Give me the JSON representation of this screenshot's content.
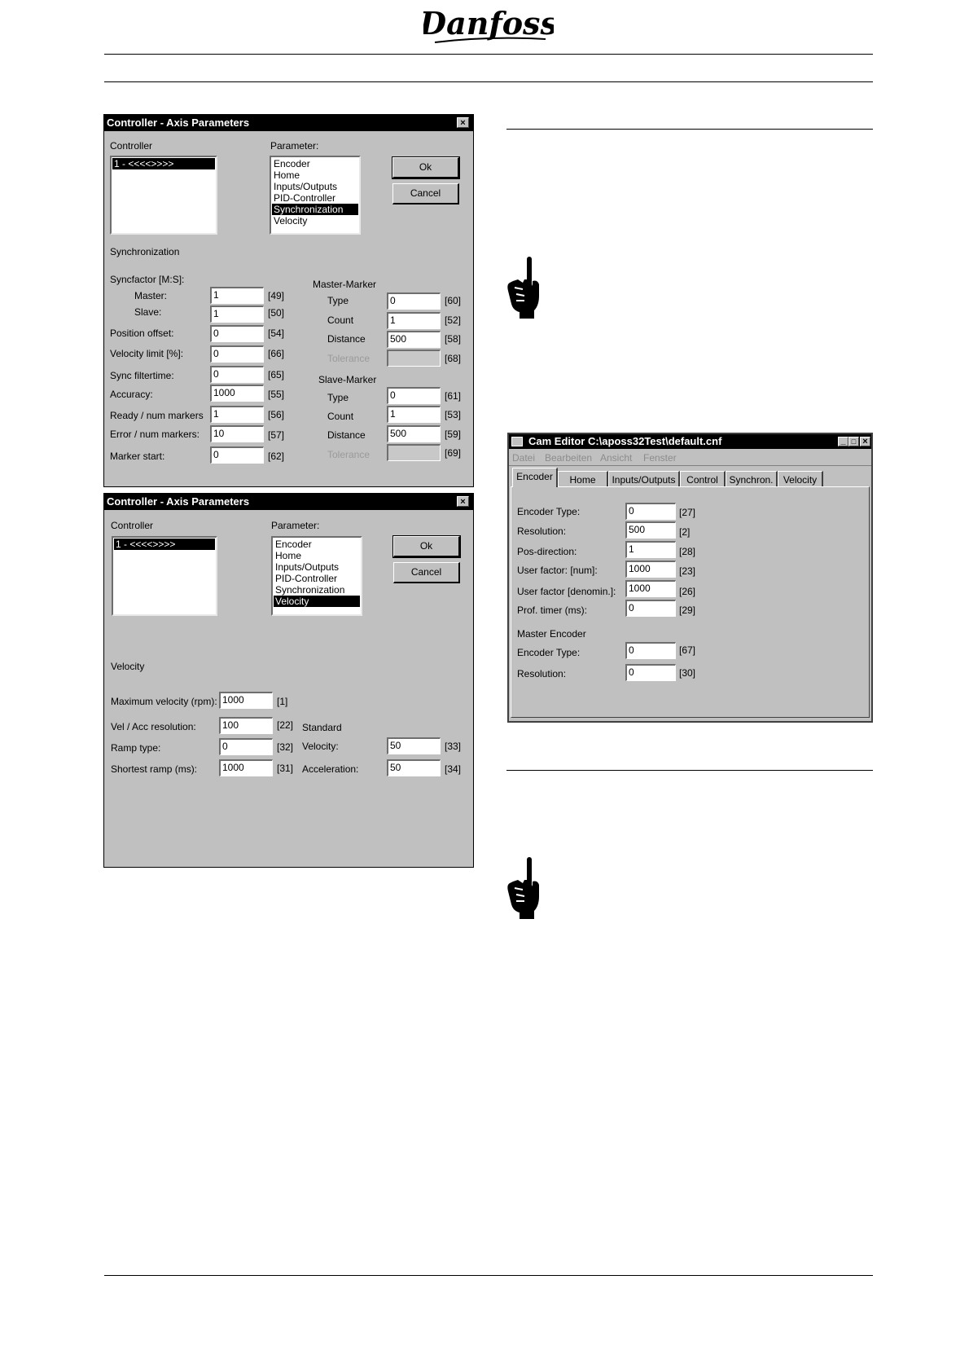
{
  "brand": {
    "logo_text": "Danfoss"
  },
  "dialog1": {
    "title": "Controller - Axis Parameters",
    "close": "×",
    "controller_label": "Controller",
    "controller_items": [
      "1 - <<<<>>>>"
    ],
    "parameter_label": "Parameter:",
    "parameter_items": [
      "Encoder",
      "Home",
      "Inputs/Outputs",
      "PID-Controller",
      "Synchronization",
      "Velocity"
    ],
    "ok": "Ok",
    "cancel": "Cancel",
    "section": "Synchronization",
    "syncfactor": "Syncfactor [M:S]:",
    "left": [
      {
        "label": "Master:",
        "value": "1",
        "code": "[49]"
      },
      {
        "label": "Slave:",
        "value": "1",
        "code": "[50]"
      },
      {
        "label": "Position offset:",
        "value": "0",
        "code": "[54]"
      },
      {
        "label": "Velocity limit [%]:",
        "value": "0",
        "code": "[66]"
      },
      {
        "label": "Sync filtertime:",
        "value": "0",
        "code": "[65]"
      },
      {
        "label": "Accuracy:",
        "value": "1000",
        "code": "[55]"
      },
      {
        "label": "Ready / num markers",
        "value": "1",
        "code": "[56]"
      },
      {
        "label": "Error / num markers:",
        "value": "10",
        "code": "[57]"
      },
      {
        "label": "Marker start:",
        "value": "0",
        "code": "[62]"
      }
    ],
    "master_marker": "Master-Marker",
    "master": [
      {
        "label": "Type",
        "value": "0",
        "code": "[60]"
      },
      {
        "label": "Count",
        "value": "1",
        "code": "[52]"
      },
      {
        "label": "Distance",
        "value": "500",
        "code": "[58]"
      },
      {
        "label": "Tolerance",
        "value": "",
        "code": "[68]"
      }
    ],
    "slave_marker": "Slave-Marker",
    "slave": [
      {
        "label": "Type",
        "value": "0",
        "code": "[61]"
      },
      {
        "label": "Count",
        "value": "1",
        "code": "[53]"
      },
      {
        "label": "Distance",
        "value": "500",
        "code": "[59]"
      },
      {
        "label": "Tolerance",
        "value": "",
        "code": "[69]"
      }
    ]
  },
  "dialog2": {
    "title": "Controller - Axis Parameters",
    "close": "×",
    "controller_label": "Controller",
    "controller_items": [
      "1 - <<<<>>>>"
    ],
    "parameter_label": "Parameter:",
    "parameter_items": [
      "Encoder",
      "Home",
      "Inputs/Outputs",
      "PID-Controller",
      "Synchronization",
      "Velocity"
    ],
    "ok": "Ok",
    "cancel": "Cancel",
    "section": "Velocity",
    "max_velocity": {
      "label": "Maximum velocity (rpm):",
      "value": "1000",
      "code": "[1]"
    },
    "left": [
      {
        "label": "Vel / Acc resolution:",
        "value": "100",
        "code": "[22]"
      },
      {
        "label": "Ramp type:",
        "value": "0",
        "code": "[32]"
      },
      {
        "label": "Shortest ramp (ms):",
        "value": "1000",
        "code": "[31]"
      }
    ],
    "standard": "Standard",
    "right": [
      {
        "label": "Velocity:",
        "value": "50",
        "code": "[33]"
      },
      {
        "label": "Acceleration:",
        "value": "50",
        "code": "[34]"
      }
    ]
  },
  "cam_editor": {
    "title": "Cam Editor C:\\aposs32Test\\default.cnf",
    "menu": [
      "Datei",
      "Bearbeiten",
      "Ansicht",
      "Fenster"
    ],
    "tabs": [
      "Encoder",
      "Home",
      "Inputs/Outputs",
      "Control",
      "Synchron.",
      "Velocity"
    ],
    "fields": [
      {
        "label": "Encoder Type:",
        "value": "0",
        "code": "[27]"
      },
      {
        "label": "Resolution:",
        "value": "500",
        "code": "[2]"
      },
      {
        "label": "Pos-direction:",
        "value": "1",
        "code": "[28]"
      },
      {
        "label": "User factor: [num]:",
        "value": "1000",
        "code": "[23]"
      },
      {
        "label": "User factor [denomin.]:",
        "value": "1000",
        "code": "[26]"
      },
      {
        "label": "Prof. timer (ms):",
        "value": "0",
        "code": "[29]"
      }
    ],
    "master_encoder": "Master Encoder",
    "master_fields": [
      {
        "label": "Encoder Type:",
        "value": "0",
        "code": "[67]"
      },
      {
        "label": "Resolution:",
        "value": "0",
        "code": "[30]"
      }
    ]
  }
}
